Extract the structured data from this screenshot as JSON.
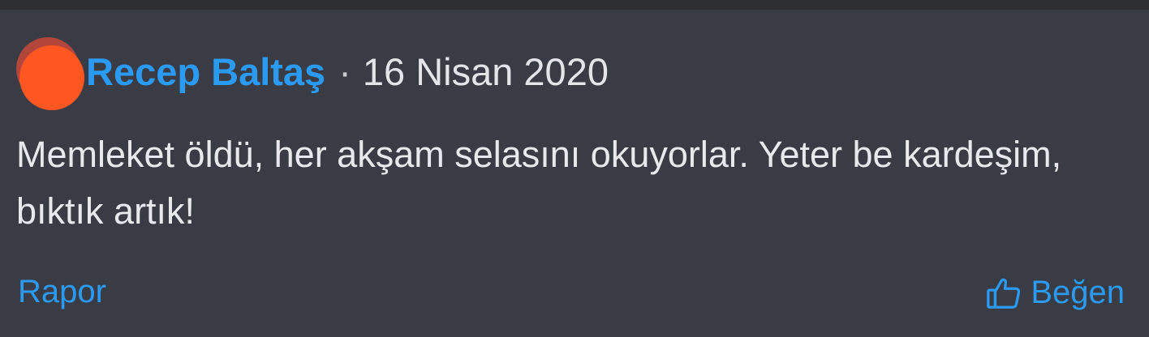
{
  "comment": {
    "author": "Recep Baltaş",
    "separator": "·",
    "date": "16 Nisan 2020",
    "text": "Memleket öldü, her akşam selasını okuyorlar. Yeter be kardeşim, bıktık artık!",
    "avatar_color": "#ff5722"
  },
  "actions": {
    "report_label": "Rapor",
    "like_label": "Beğen",
    "like_icon": "thumbs-up-icon"
  },
  "colors": {
    "accent": "#2b9af3",
    "background": "#3a3c45"
  }
}
